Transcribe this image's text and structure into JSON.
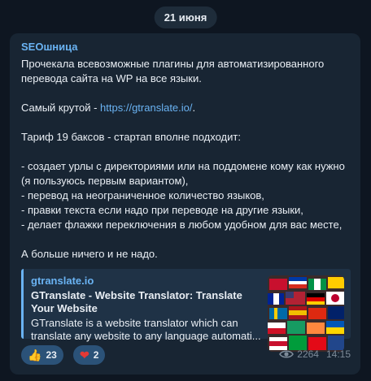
{
  "date": "21 июня",
  "message": {
    "sender": "SEOшница",
    "paragraphs": [
      "Прочекала всевозможные плагины для автоматизированного перевода сайта на WP на все языки."
    ],
    "best_prefix": "Самый крутой - ",
    "best_link": "https://gtranslate.io/",
    "best_suffix": ".",
    "tariff": "Тариф 19 баксов - стартап вполне подходит:",
    "bullets": [
      "- создает урлы с директориями или на поддомене кому как нужно (я пользуюсь первым вариантом),",
      "- перевод на неограниченное количество языков,",
      "- правки текста если надо при переводе на другие языки,",
      "- делает флажки переключения в любом удобном для вас месте,"
    ],
    "closing": "А больше ничего и не надо."
  },
  "preview": {
    "site": "gtranslate.io",
    "title": "GTranslate - Website Translator: Translate Your Website",
    "desc_line1": "GTranslate is a website translator which can",
    "desc_line2": "translate any website to any language automati..."
  },
  "reactions": [
    {
      "emoji": "👍",
      "count": "23",
      "icon": "thumbs-up-icon"
    },
    {
      "emoji": "❤",
      "count": "2",
      "icon": "heart-icon"
    }
  ],
  "views": "2264",
  "time": "14:15"
}
